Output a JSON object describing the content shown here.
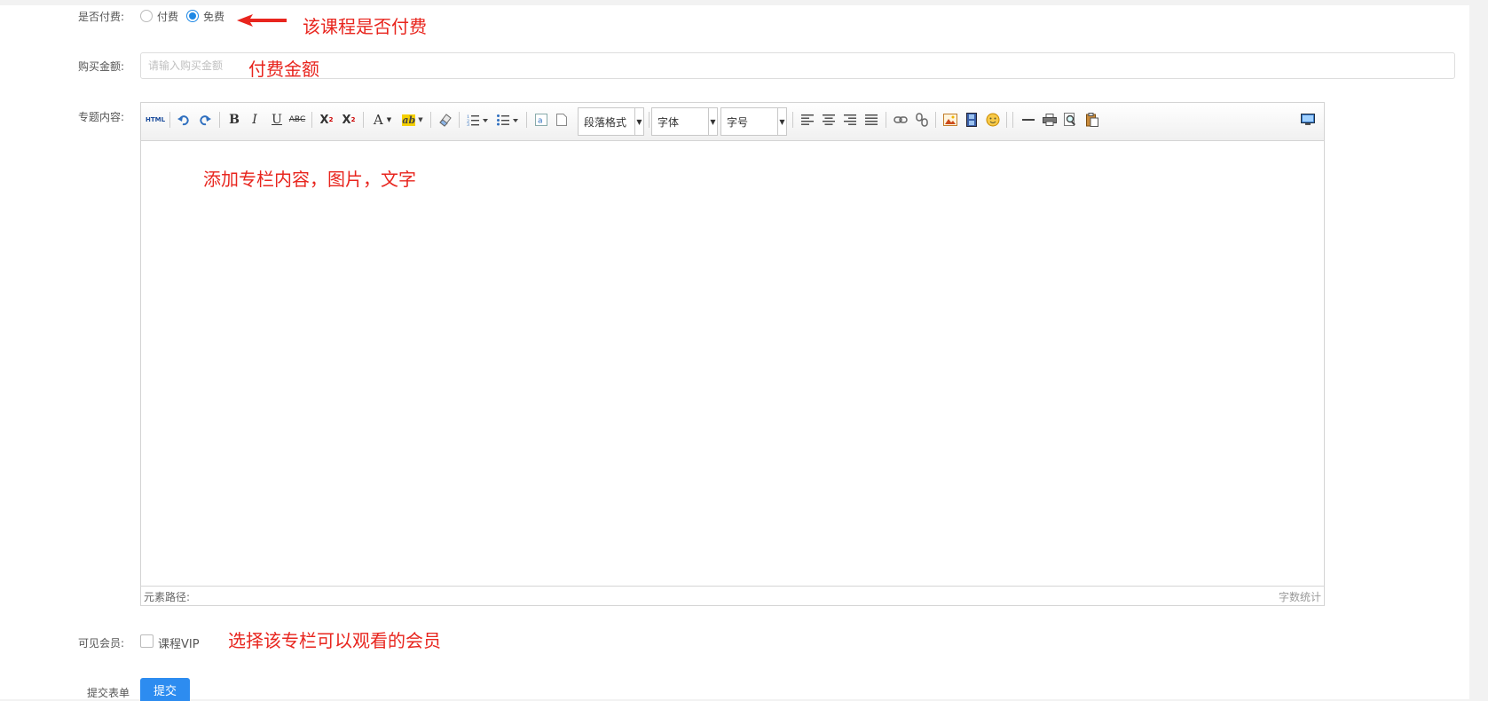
{
  "form": {
    "paid_label": "是否付费:",
    "paid_option": "付费",
    "free_option": "免费",
    "price_label": "购买金额:",
    "price_placeholder": "请输入购买金额",
    "content_label": "专题内容:",
    "vip_label": "可见会员:",
    "vip_option": "课程VIP",
    "submit_label": "提交表单",
    "submit_button": "提交"
  },
  "editor": {
    "paragraph_combo": "段落格式",
    "font_combo": "字体",
    "size_combo": "字号",
    "html_button": "HTML",
    "element_path": "元素路径:",
    "word_count": "字数统计"
  },
  "annotations": {
    "paid": "该课程是否付费",
    "price": "付费金额",
    "content": "添加专栏内容，图片，文字",
    "vip": "选择该专栏可以观看的会员"
  },
  "colors": {
    "annotation": "#e8251e",
    "primary": "#2d8cf0",
    "radio_checked": "#1e88e5"
  }
}
